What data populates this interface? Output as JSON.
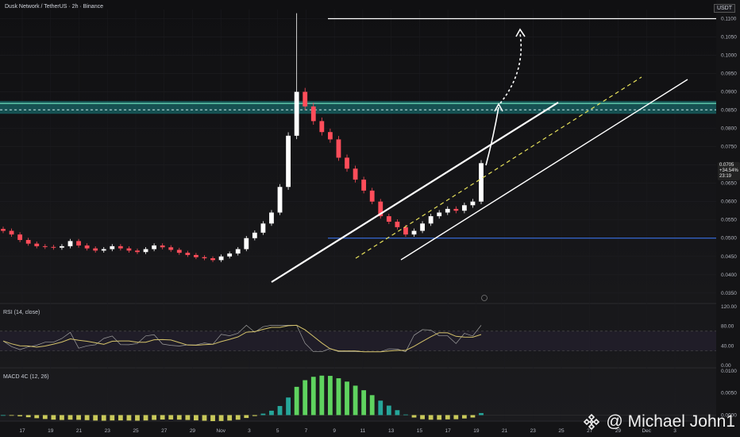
{
  "header": {
    "title": "Dusk Network / TetherUS · 2h · Binance"
  },
  "unit_badge": "USDT",
  "price_panel": {
    "ticks": [
      "0.1100",
      "0.1050",
      "0.1000",
      "0.0950",
      "0.0900",
      "0.0850",
      "0.0800",
      "0.0750",
      "0.0700",
      "0.0650",
      "0.0600",
      "0.0550",
      "0.0500",
      "0.0450",
      "0.0400",
      "0.0350"
    ],
    "last_price": {
      "value": "0.0705",
      "change": "+34.54%",
      "countdown": "23:19"
    }
  },
  "rsi_panel": {
    "title": "RSI (14, close)",
    "ticks": [
      "120.00",
      "80.00",
      "40.00",
      "0.00"
    ]
  },
  "macd_panel": {
    "title": "MACD 4C (12, 26)",
    "ticks": [
      "0.0100",
      "0.0050",
      "0.0000"
    ]
  },
  "time_axis": {
    "labels": [
      "17",
      "19",
      "21",
      "23",
      "25",
      "27",
      "29",
      "Nov",
      "3",
      "5",
      "7",
      "9",
      "11",
      "13",
      "15",
      "17",
      "19",
      "21",
      "23",
      "25",
      "27",
      "29",
      "Dec",
      "3"
    ]
  },
  "watermark": {
    "text": "@ Michael John1"
  },
  "colors": {
    "background": "#141416",
    "bull": "#ffffff",
    "bear": "#ff4d5a",
    "zone": "#1aa7a7",
    "support": "#3d7bff",
    "rsi": "#d4c26a",
    "macd_up": "#26a69a",
    "macd_up_strong": "#5fd35f",
    "macd_down": "#c9c95a"
  },
  "chart_data": {
    "type": "candlestick",
    "title": "Dusk Network / TetherUS · 2h · Binance",
    "y_unit": "USDT",
    "ylim": [
      0.033,
      0.1125
    ],
    "x_labels": [
      "17",
      "19",
      "21",
      "23",
      "25",
      "27",
      "29",
      "Nov",
      "3",
      "5",
      "7",
      "9",
      "11",
      "13",
      "15",
      "17",
      "19",
      "21",
      "23",
      "25",
      "27",
      "29",
      "Dec",
      "3"
    ],
    "series_close_approx": [
      0.052,
      0.051,
      0.0495,
      0.0485,
      0.0478,
      0.0476,
      0.0474,
      0.0478,
      0.0492,
      0.048,
      0.0472,
      0.0466,
      0.047,
      0.0478,
      0.0472,
      0.0466,
      0.0462,
      0.047,
      0.048,
      0.0475,
      0.0468,
      0.046,
      0.0454,
      0.0448,
      0.0445,
      0.044,
      0.045,
      0.0458,
      0.047,
      0.05,
      0.0515,
      0.054,
      0.057,
      0.064,
      0.078,
      0.09,
      0.086,
      0.082,
      0.079,
      0.077,
      0.072,
      0.069,
      0.066,
      0.063,
      0.06,
      0.056,
      0.0545,
      0.053,
      0.051,
      0.052,
      0.054,
      0.056,
      0.057,
      0.058,
      0.0575,
      0.059,
      0.06,
      0.0705
    ],
    "spike_high": 0.1115,
    "last_close": 0.0705,
    "last_change_pct": 34.54,
    "annotations": {
      "target_line": 0.11,
      "resistance_zone": [
        0.084,
        0.0875
      ],
      "support_line": 0.05,
      "projection_target": 0.11,
      "channel": "ascending parallel channel with dashed midline"
    },
    "rsi": {
      "period": 14,
      "source": "close",
      "levels": [
        70,
        30
      ],
      "ylim": [
        0,
        120
      ]
    },
    "macd": {
      "fast": 12,
      "slow": 26,
      "ylim": [
        -0.001,
        0.01
      ]
    }
  }
}
